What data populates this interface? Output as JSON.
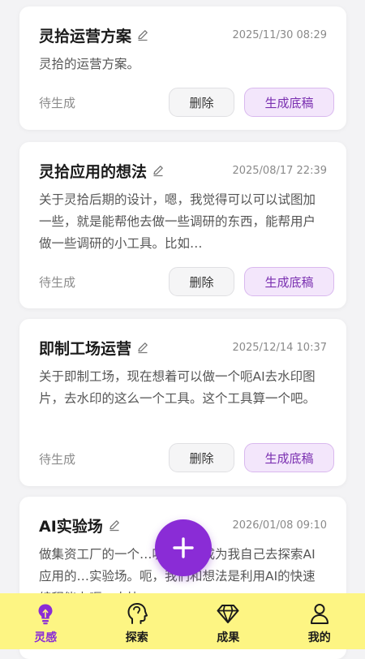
{
  "cards": [
    {
      "title": "灵拾运营方案",
      "date": "2025/11/30 08:29",
      "body": "灵拾的运营方案。",
      "status": "待生成",
      "delete_label": "删除",
      "generate_label": "生成底稿"
    },
    {
      "title": "灵拾应用的想法",
      "date": "2025/08/17 22:39",
      "body": "关于灵拾后期的设计，嗯，我觉得可以可以试图加一些，就是能帮他去做一些调研的东西，能帮用户做一些调研的小工具。比如…",
      "status": "待生成",
      "delete_label": "删除",
      "generate_label": "生成底稿"
    },
    {
      "title": "即制工场运营",
      "date": "2025/12/14 10:37",
      "body": "关于即制工场，现在想着可以做一个呃AI去水印图片，去水印的这么一个工具。这个工具算一个吧。",
      "status": "待生成",
      "delete_label": "删除",
      "generate_label": "生成底稿"
    },
    {
      "title": "AI实验场",
      "date": "2026/01/08 09:10",
      "body": "做集资工厂的一个…呃希望他成为我自己去探索AI应用的…实验场。呃，我们和想法是利用AI的快速编程能力呃，去快"
    }
  ],
  "fab": {
    "icon": "plus-icon"
  },
  "tabs": [
    {
      "label": "灵感",
      "icon": "bulb-icon",
      "active": true
    },
    {
      "label": "探索",
      "icon": "head-icon",
      "active": false
    },
    {
      "label": "成果",
      "icon": "diamond-icon",
      "active": false
    },
    {
      "label": "我的",
      "icon": "user-icon",
      "active": false
    }
  ],
  "colors": {
    "accent": "#8a2cd6",
    "tabbar_bg": "#fdf583",
    "background": "#f3f3f5",
    "generate_bg": "#f3e6fb"
  }
}
